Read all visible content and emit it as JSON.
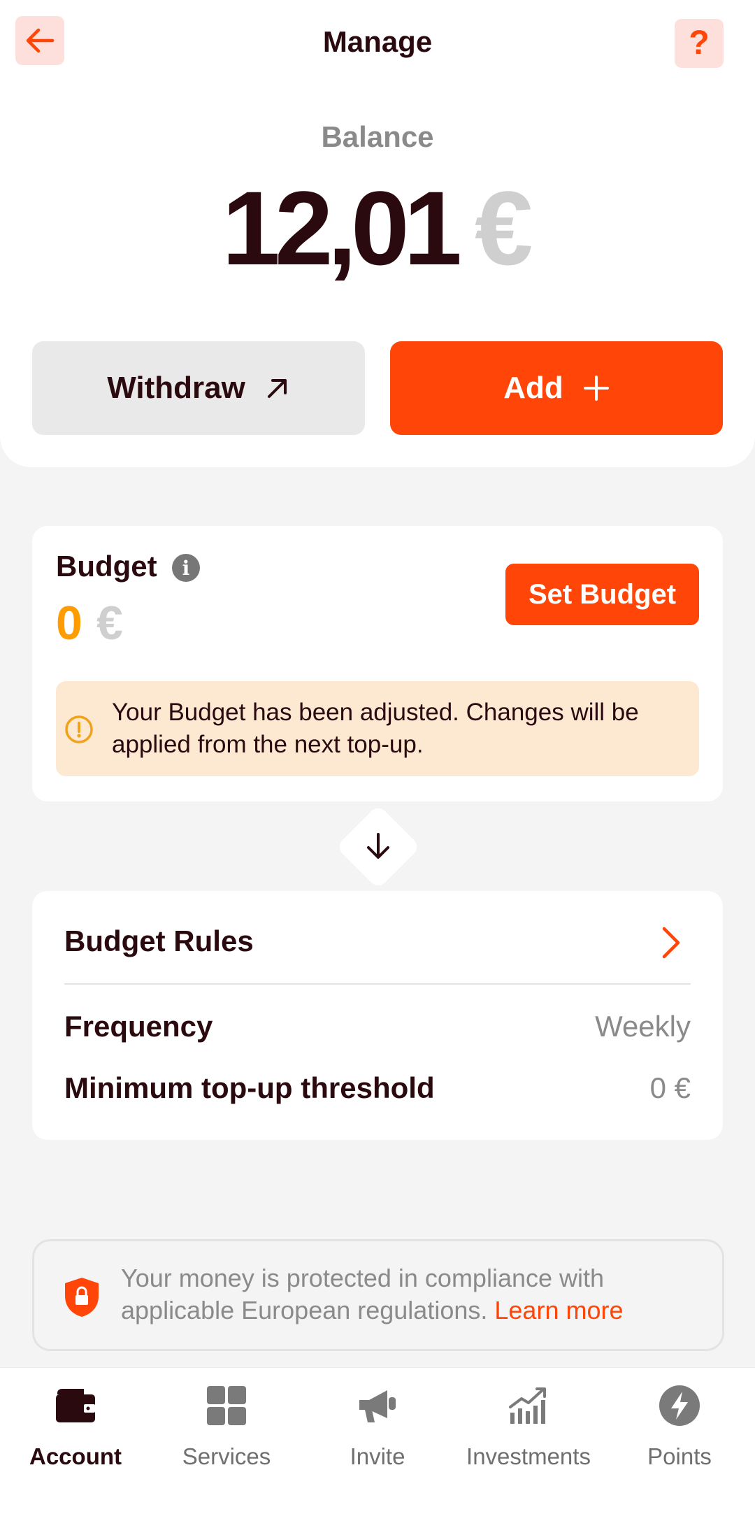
{
  "header": {
    "title": "Manage",
    "help_label": "?"
  },
  "balance": {
    "label": "Balance",
    "amount": "12,01",
    "currency": "€"
  },
  "actions": {
    "withdraw_label": "Withdraw",
    "add_label": "Add"
  },
  "budget": {
    "title": "Budget",
    "info_glyph": "i",
    "amount": "0",
    "currency": "€",
    "set_button": "Set Budget",
    "notice": "Your Budget has been adjusted. Changes will be applied from the next top-up."
  },
  "rules": {
    "title": "Budget Rules",
    "rows": [
      {
        "label": "Frequency",
        "value": "Weekly"
      },
      {
        "label": "Minimum top-up threshold",
        "value": "0 €"
      }
    ]
  },
  "protection": {
    "text": "Your money is protected in compliance with applicable European regulations.",
    "link": "Learn more"
  },
  "nav": {
    "items": [
      {
        "label": "Account",
        "icon": "wallet-icon"
      },
      {
        "label": "Services",
        "icon": "grid-icon"
      },
      {
        "label": "Invite",
        "icon": "megaphone-icon"
      },
      {
        "label": "Investments",
        "icon": "chart-icon"
      },
      {
        "label": "Points",
        "icon": "bolt-icon"
      }
    ],
    "active": "Account"
  },
  "colors": {
    "accent": "#ff4508",
    "budget_amount": "#ff9d00",
    "notice_bg": "#fde8d2",
    "text_dark": "#2a0a0f",
    "muted": "#8a8a8a"
  }
}
